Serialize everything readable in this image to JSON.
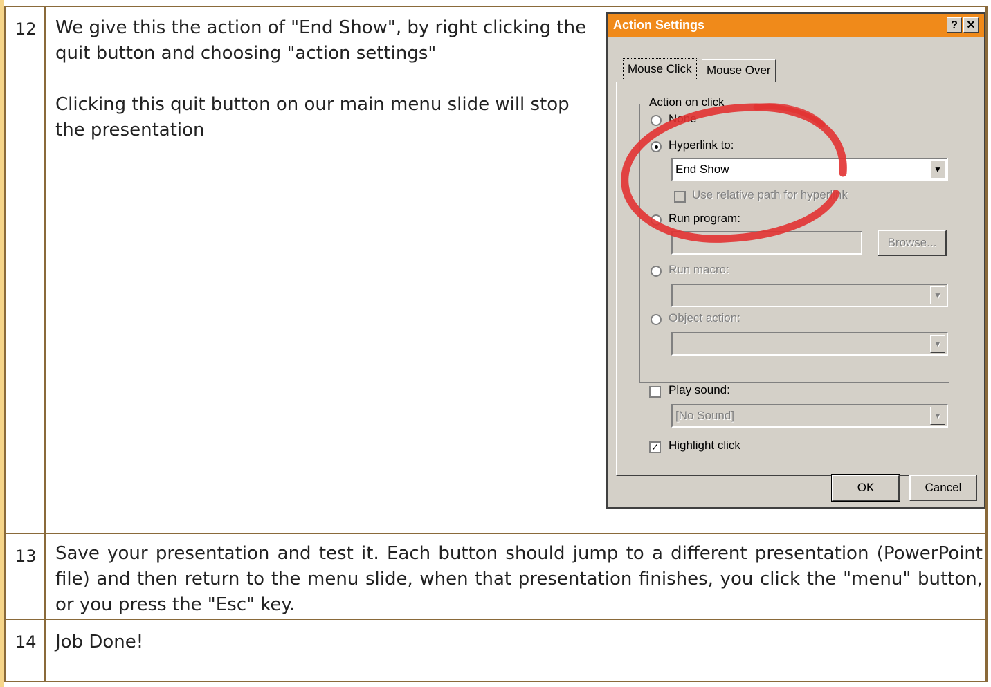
{
  "rows": [
    {
      "number": "12",
      "paragraphs": [
        "We give this the action of \"End Show\", by right clicking the quit button and choosing \"action settings\"",
        "Clicking this quit button on our main menu slide will stop the presentation"
      ]
    },
    {
      "number": "13",
      "paragraphs": [
        "Save your presentation and test it. Each button should jump to a different presentation (PowerPoint file) and then return to the menu slide, when that presentation finishes, you click the \"menu\" button, or you press the \"Esc\" key."
      ]
    },
    {
      "number": "14",
      "paragraphs": [
        "Job Done!"
      ]
    }
  ],
  "dialog": {
    "title": "Action Settings",
    "help_button": "?",
    "close_button": "✕",
    "tabs": [
      "Mouse Click",
      "Mouse Over"
    ],
    "group_label": "Action on click",
    "options": {
      "none": "None",
      "hyperlink": "Hyperlink to:",
      "hyperlink_value": "End Show",
      "relative_path": "Use relative path for hyperlink",
      "run_program": "Run program:",
      "browse": "Browse...",
      "run_macro": "Run macro:",
      "object_action": "Object action:"
    },
    "play_sound": "Play sound:",
    "sound_value": "[No Sound]",
    "highlight_click": "Highlight click",
    "ok": "OK",
    "cancel": "Cancel",
    "dropdown_arrow": "▼",
    "check_mark": "✓"
  },
  "colors": {
    "titlebar": "#f08a1a",
    "table_border": "#8a6a3a",
    "annotation_circle": "#e23232"
  }
}
